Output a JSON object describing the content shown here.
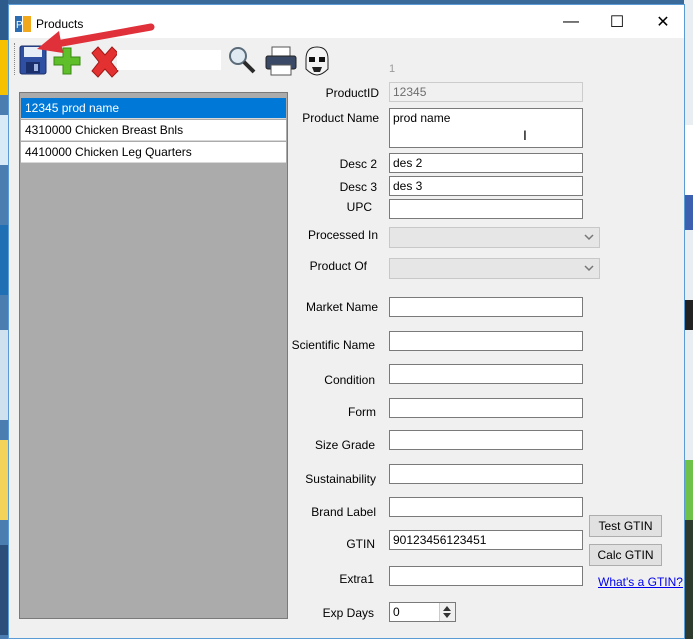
{
  "window": {
    "title": "Products",
    "minimize_glyph": "—",
    "maximize_glyph": "☐",
    "close_glyph": "✕"
  },
  "toolbar": {
    "search_value": "",
    "icons": [
      "save-icon",
      "add-icon",
      "delete-icon",
      "search-icon",
      "print-icon",
      "stormtrooper-icon"
    ],
    "annotation_color": "#e0303a"
  },
  "products": [
    {
      "label": "12345 prod name",
      "selected": true
    },
    {
      "label": "4310000 Chicken Breast Bnls",
      "selected": false
    },
    {
      "label": "4410000 Chicken Leg Quarters",
      "selected": false
    }
  ],
  "form": {
    "record_index": "1",
    "product_id": {
      "label": "ProductID",
      "value": "12345"
    },
    "product_name": {
      "label": "Product Name",
      "value": "prod name"
    },
    "desc2": {
      "label": "Desc 2",
      "value": "des 2"
    },
    "desc3": {
      "label": "Desc 3",
      "value": "des 3"
    },
    "upc": {
      "label": "UPC",
      "value": ""
    },
    "processed_in": {
      "label": "Processed In",
      "value": ""
    },
    "product_of": {
      "label": "Product Of",
      "value": ""
    },
    "market_name": {
      "label": "Market Name",
      "value": ""
    },
    "scientific_name": {
      "label": "Scientific Name",
      "value": ""
    },
    "condition": {
      "label": "Condition",
      "value": ""
    },
    "form_field": {
      "label": "Form",
      "value": ""
    },
    "size_grade": {
      "label": "Size Grade",
      "value": ""
    },
    "sustainability": {
      "label": "Sustainability",
      "value": ""
    },
    "brand_label": {
      "label": "Brand Label",
      "value": ""
    },
    "gtin": {
      "label": "GTIN",
      "value": "90123456123451"
    },
    "extra1": {
      "label": "Extra1",
      "value": ""
    },
    "exp_days": {
      "label": "Exp Days",
      "value": "0"
    },
    "test_gtin_button": "Test GTIN",
    "calc_gtin_button": "Calc GTIN",
    "whats_gtin_link": "What's a GTIN?"
  },
  "colors": {
    "selection": "#0078d7",
    "list_background": "#ababab",
    "link": "#0000ee"
  }
}
